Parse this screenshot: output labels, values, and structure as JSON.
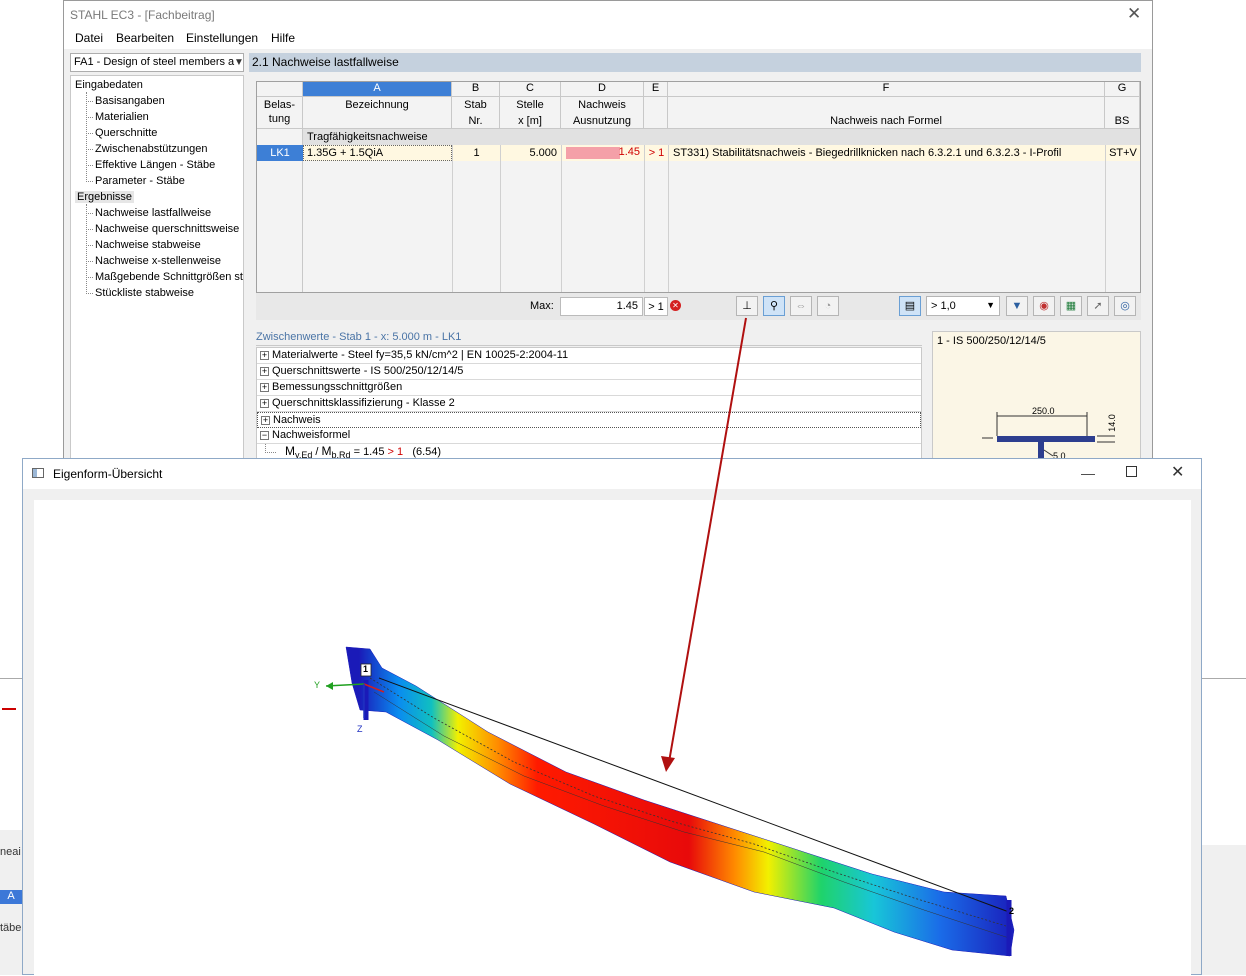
{
  "main_window": {
    "title": "STAHL EC3 - [Fachbeitrag]",
    "menu": [
      "Datei",
      "Bearbeiten",
      "Einstellungen",
      "Hilfe"
    ],
    "case_combo": "FA1 - Design of steel members a",
    "nav": {
      "input_group": "Eingabedaten",
      "input_items": [
        "Basisangaben",
        "Materialien",
        "Querschnitte",
        "Zwischenabstützungen",
        "Effektive Längen - Stäbe",
        "Parameter - Stäbe"
      ],
      "results_group": "Ergebnisse",
      "results_items": [
        "Nachweise lastfallweise",
        "Nachweise querschnittsweise",
        "Nachweise stabweise",
        "Nachweise x-stellenweise",
        "Maßgebende Schnittgrößen sta",
        "Stückliste stabweise"
      ]
    },
    "section_title": "2.1 Nachweise lastfallweise"
  },
  "table": {
    "col_letters": [
      "A",
      "B",
      "C",
      "D",
      "E",
      "F",
      "G"
    ],
    "col_headers": {
      "load_case": [
        "Belas-",
        "tung"
      ],
      "a": [
        "",
        "Bezeichnung"
      ],
      "b": [
        "Stab",
        "Nr."
      ],
      "c": [
        "Stelle",
        "x [m]"
      ],
      "d": [
        "Nachweis",
        "Ausnutzung"
      ],
      "e": [
        "",
        ""
      ],
      "f": [
        "",
        "Nachweis nach Formel"
      ],
      "g": [
        "",
        "BS"
      ]
    },
    "group_row": "Tragfähigkeitsnachweise",
    "rows": [
      {
        "lc": "LK1",
        "designation": "1.35G + 1.5QiA",
        "member": "1",
        "x": "5.000",
        "ratio": "1.45",
        "gt": "> 1",
        "formula": "ST331) Stabilitätsnachweis - Biegedrillknicken nach 6.3.2.1 und 6.3.2.3 - I-Profil",
        "ds": "ST+V"
      }
    ],
    "max_label": "Max:",
    "max_value": "1.45",
    "max_gt": "> 1",
    "filter_combo": "> 1,0"
  },
  "interim": {
    "title": "Zwischenwerte - Stab 1 - x: 5.000 m - LK1",
    "rows": [
      {
        "sign": "+",
        "text": "Materialwerte - Steel fy=35,5 kN/cm^2 | EN 10025-2:2004-11"
      },
      {
        "sign": "+",
        "text": "Querschnittswerte  -  IS 500/250/12/14/5"
      },
      {
        "sign": "+",
        "text": "Bemessungsschnittgrößen"
      },
      {
        "sign": "+",
        "text": "Querschnittsklassifizierung - Klasse 2"
      },
      {
        "sign": "+",
        "text": "Nachweis"
      },
      {
        "sign": "−",
        "text": "Nachweisformel"
      }
    ],
    "formula": {
      "lhs": "M",
      "lhs_sub": "y,Ed",
      "rhs": "M",
      "rhs_sub": "b,Rd",
      "eq": " = 1.45 ",
      "gt": "> 1",
      "ref": "(6.54)"
    }
  },
  "section_view": {
    "title": "1 - IS 500/250/12/14/5",
    "width_dim": "250.0",
    "flange_dim": "14.0",
    "web_dim": "5.0"
  },
  "popup": {
    "title": "Eigenform-Übersicht",
    "axis_y": "Y",
    "axis_z": "Z",
    "node_start": "1",
    "node_end": "2"
  },
  "colors": {
    "accent_header": "#c5d1de",
    "ratio_fill": "#f4a0a8",
    "exceed_red": "#d00000",
    "arrow": "#b01010"
  },
  "background": {
    "left_fragments": [
      "neai",
      "A",
      "täbe"
    ]
  }
}
